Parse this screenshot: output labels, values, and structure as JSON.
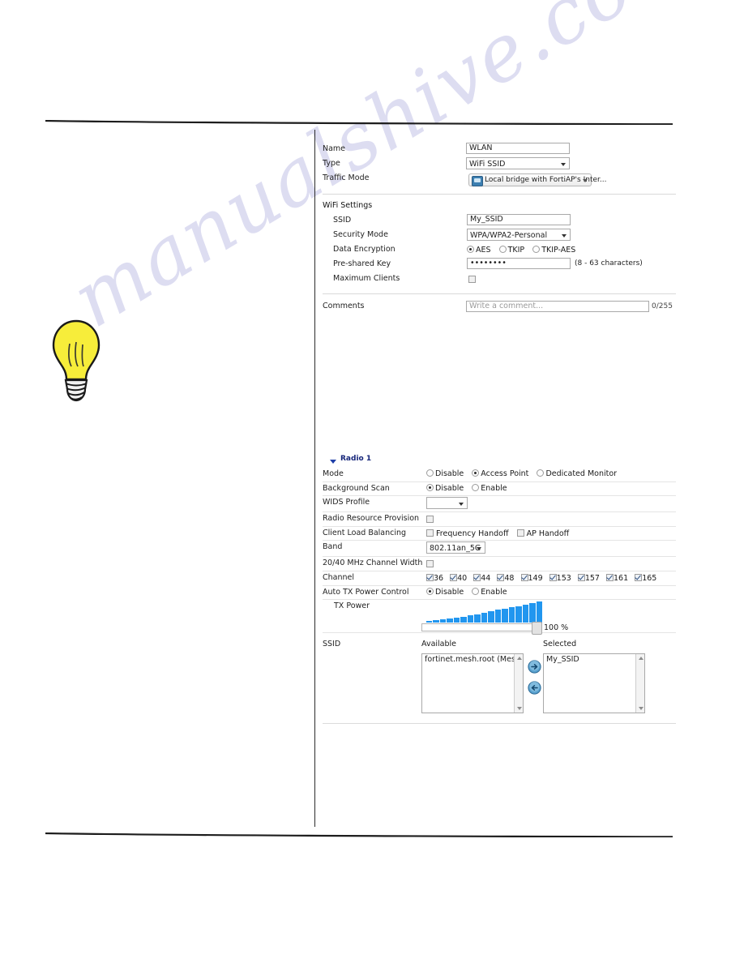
{
  "document": {
    "watermark": "manualshive.com",
    "tip_icon": "lightbulb-icon"
  },
  "form": {
    "fields": [
      {
        "label": "Name",
        "type": "text",
        "value": "WLAN"
      },
      {
        "label": "Type",
        "type": "select",
        "value": "WiFi SSID"
      },
      {
        "label": "Traffic Mode",
        "type": "button-select",
        "value": "Local bridge with FortiAP's Inter...",
        "icon": "bridge-icon"
      }
    ],
    "wifi_settings": {
      "title": "WiFi Settings",
      "ssid": {
        "label": "SSID",
        "value": "My_SSID"
      },
      "security_mode": {
        "label": "Security Mode",
        "value": "WPA/WPA2-Personal"
      },
      "data_encryption": {
        "label": "Data Encryption",
        "options": [
          "AES",
          "TKIP",
          "TKIP-AES"
        ],
        "selected": "AES"
      },
      "pre_shared_key": {
        "label": "Pre-shared Key",
        "value": "••••••••",
        "hint": "(8 - 63 characters)"
      },
      "maximum_clients": {
        "label": "Maximum Clients",
        "checked": false
      }
    },
    "comments": {
      "label": "Comments",
      "value": "",
      "placeholder": "Write a comment...",
      "counter": "0/255"
    }
  },
  "radio1": {
    "title": "Radio 1",
    "mode": {
      "label": "Mode",
      "options": [
        "Disable",
        "Access Point",
        "Dedicated Monitor"
      ],
      "selected": "Access Point"
    },
    "background_scan": {
      "label": "Background Scan",
      "options": [
        "Disable",
        "Enable"
      ],
      "selected": "Disable"
    },
    "wids_profile": {
      "label": "WIDS Profile",
      "value": ""
    },
    "radio_resource_provision": {
      "label": "Radio Resource Provision",
      "checked": false
    },
    "client_load_balancing": {
      "label": "Client Load Balancing",
      "options": [
        {
          "label": "Frequency Handoff",
          "checked": false
        },
        {
          "label": "AP Handoff",
          "checked": false
        }
      ]
    },
    "band": {
      "label": "Band",
      "value": "802.11an_5G"
    },
    "channel_width": {
      "label": "20/40 MHz Channel Width",
      "checked": false
    },
    "channel": {
      "label": "Channel",
      "items": [
        {
          "label": "36",
          "checked": true
        },
        {
          "label": "40",
          "checked": true
        },
        {
          "label": "44",
          "checked": true
        },
        {
          "label": "48",
          "checked": true
        },
        {
          "label": "149",
          "checked": true
        },
        {
          "label": "153",
          "checked": true
        },
        {
          "label": "157",
          "checked": true
        },
        {
          "label": "161",
          "checked": true
        },
        {
          "label": "165",
          "checked": true
        }
      ]
    },
    "auto_tx_power_control": {
      "label": "Auto TX Power Control",
      "options": [
        "Disable",
        "Enable"
      ],
      "selected": "Disable"
    },
    "tx_power": {
      "label": "TX Power",
      "value": "100 %",
      "percent": 100,
      "bar_color": "#2196ef",
      "bars": [
        2,
        3,
        4,
        5,
        6,
        7,
        9,
        10,
        12,
        13,
        15,
        16,
        18,
        19,
        21,
        23,
        25
      ]
    },
    "ssid_picker": {
      "label": "SSID",
      "available_header": "Available",
      "selected_header": "Selected",
      "available": [
        "fortinet.mesh.root (Mesh"
      ],
      "selected": [
        "My_SSID"
      ],
      "add_icon": "arrow-right-icon",
      "remove_icon": "arrow-left-icon"
    }
  }
}
